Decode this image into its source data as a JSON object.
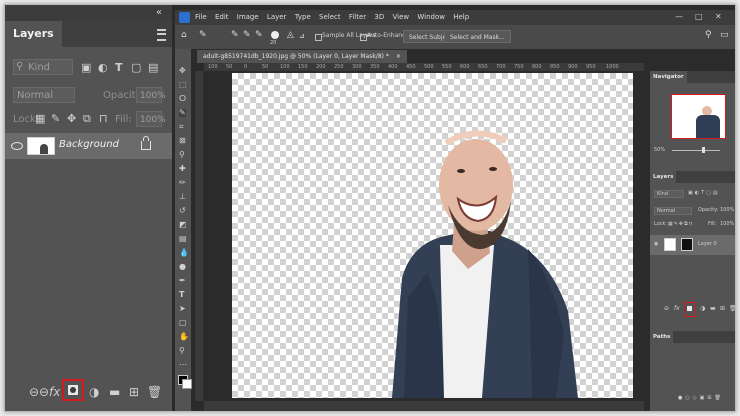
{
  "left_panel": {
    "collapse": "«",
    "tab": "Layers",
    "filter_placeholder": "Kind",
    "blend_mode": "Normal",
    "opacity_label": "Opacity:",
    "opacity_value": "100%",
    "lock_label": "Lock:",
    "fill_label": "Fill:",
    "fill_value": "100%",
    "layer_name": "Background",
    "bottom_icons": [
      "link-icon",
      "fx-icon",
      "add-mask-icon",
      "adjustment-icon",
      "group-icon",
      "new-layer-icon",
      "delete-icon"
    ]
  },
  "menubar": {
    "items": [
      "File",
      "Edit",
      "Image",
      "Layer",
      "Type",
      "Select",
      "Filter",
      "3D",
      "View",
      "Window",
      "Help"
    ],
    "minimize": "—",
    "maximize": "□",
    "close": "✕"
  },
  "options_bar": {
    "brush_size": "20",
    "sample_all": "Sample All Layers",
    "auto_enhance": "Auto-Enhance",
    "select_subject": "Select Subject",
    "select_mask": "Select and Mask..."
  },
  "document": {
    "tab_title": "adult-g8519741db_1920.jpg @ 50% (Layer 0, Layer Mask/8) *",
    "close": "×",
    "ruler_ticks": [
      "100",
      "50",
      "0",
      "50",
      "100",
      "150",
      "200",
      "250",
      "300",
      "350",
      "400",
      "450",
      "500",
      "550",
      "600",
      "650",
      "700",
      "750",
      "800",
      "850",
      "900",
      "950",
      "1000"
    ]
  },
  "navigator": {
    "title": "Navigator",
    "zoom": "50%"
  },
  "right_layers": {
    "title": "Layers",
    "filter_placeholder": "Kind",
    "blend_mode": "Normal",
    "opacity_label": "Opacity:",
    "opacity_value": "100%",
    "lock_label": "Lock:",
    "fill_label": "Fill:",
    "fill_value": "100%",
    "layer_name": "Layer 0"
  },
  "paths": {
    "title": "Paths"
  }
}
